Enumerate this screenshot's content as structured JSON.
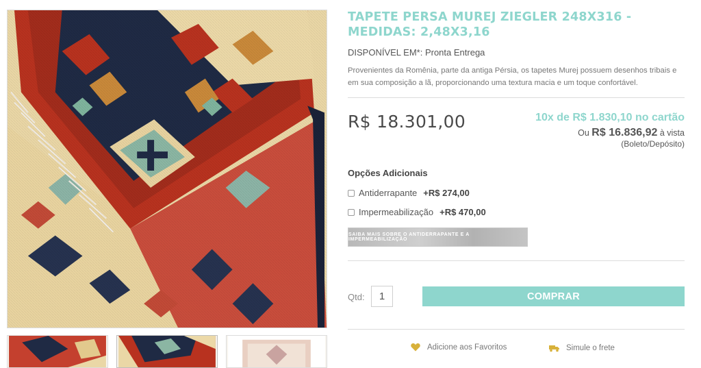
{
  "product": {
    "title": "TAPETE PERSA MUREJ ZIEGLER 248X316 - MEDIDAS: 2,48X3,16",
    "availability_label": "DISPONÍVEL EM*:",
    "availability_value": "Pronta Entrega",
    "description": "Provenientes da Romênia, parte da antiga Pérsia, os tapetes Murej possuem desenhos tribais e em sua composição a lã, proporcionando uma textura macia e um toque confortável."
  },
  "pricing": {
    "price": "R$ 18.301,00",
    "installments": "10x de R$ 1.830,10 no cartão",
    "cash_prefix": "Ou",
    "cash_amount": "R$ 16.836,92",
    "cash_suffix": "à vista",
    "cash_note": "(Boleto/Depósito)"
  },
  "options": {
    "title": "Opções Adicionais",
    "items": [
      {
        "label": "Antiderrapante",
        "price": "+R$ 274,00",
        "checked": false
      },
      {
        "label": "Impermeabilização",
        "price": "+R$ 470,00",
        "checked": false
      }
    ],
    "info_banner": "SAIBA MAIS SOBRE O ANTIDERRAPANTE E A IMPERMEABILIZAÇÃO"
  },
  "purchase": {
    "qty_label": "Qtd:",
    "qty_value": "1",
    "buy_label": "COMPRAR"
  },
  "actions": {
    "favorite_label": "Adicione aos Favoritos",
    "shipping_label": "Simule o frete"
  },
  "colors": {
    "accent": "#8ed6cd",
    "rug_red": "#b8321f",
    "rug_navy": "#1f2a44",
    "rug_cream": "#ecd9a8",
    "heart": "#d8b13a"
  },
  "icons": {
    "favorite": "heart-icon",
    "shipping": "truck-icon"
  }
}
